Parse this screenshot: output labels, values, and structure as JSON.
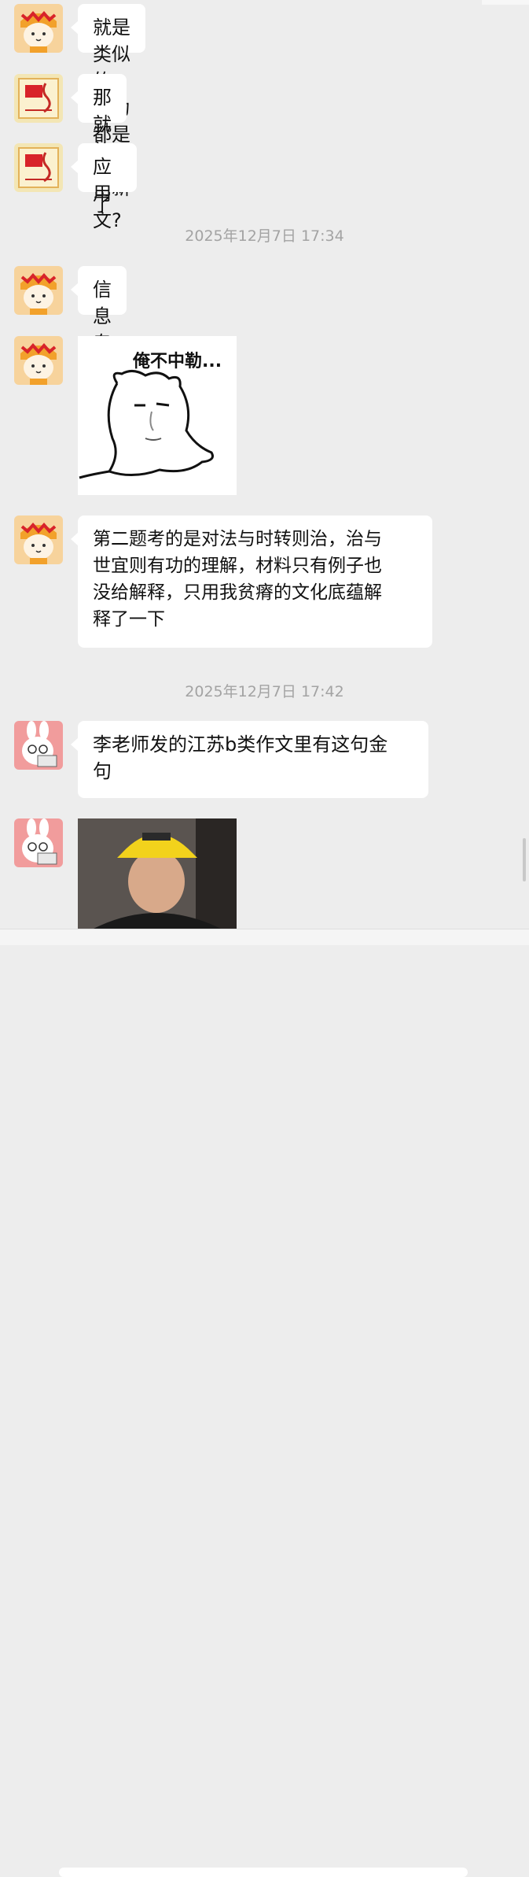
{
  "chat": {
    "messages": [
      {
        "avatar": "cat-girl-avatar",
        "text": "就是类似的，因为都是写的创新"
      },
      {
        "avatar": "flag-avatar",
        "text": "那就放心了"
      },
      {
        "avatar": "flag-avatar",
        "text": "应用文?"
      },
      {
        "timestamp": "2025年12月7日 17:34"
      },
      {
        "avatar": "cat-girl-avatar",
        "text": "信息专报"
      },
      {
        "avatar": "cat-girl-avatar",
        "sticker_text": "俺不中勒..."
      },
      {
        "avatar": "cat-girl-avatar",
        "text": "第二题考的是对法与时转则治，治与\n世宜则有功的理解，材料只有例子也\n没给解释，只用我贫瘠的文化底蕴解\n释了一下"
      },
      {
        "timestamp": "2025年12月7日 17:42"
      },
      {
        "avatar": "bunny-avatar",
        "text": "李老师发的江苏b类作文里有这句金\n句"
      },
      {
        "avatar": "bunny-avatar",
        "photo": "video-thumbnail"
      }
    ]
  },
  "colors": {
    "background": "#ededed",
    "bubble": "#ffffff",
    "timestamp": "#a3a3a3",
    "cat_avatar_bg": "#f7d39c",
    "flag_avatar_bg": "#f3e6b5",
    "bunny_avatar_bg": "#f19c9c"
  }
}
